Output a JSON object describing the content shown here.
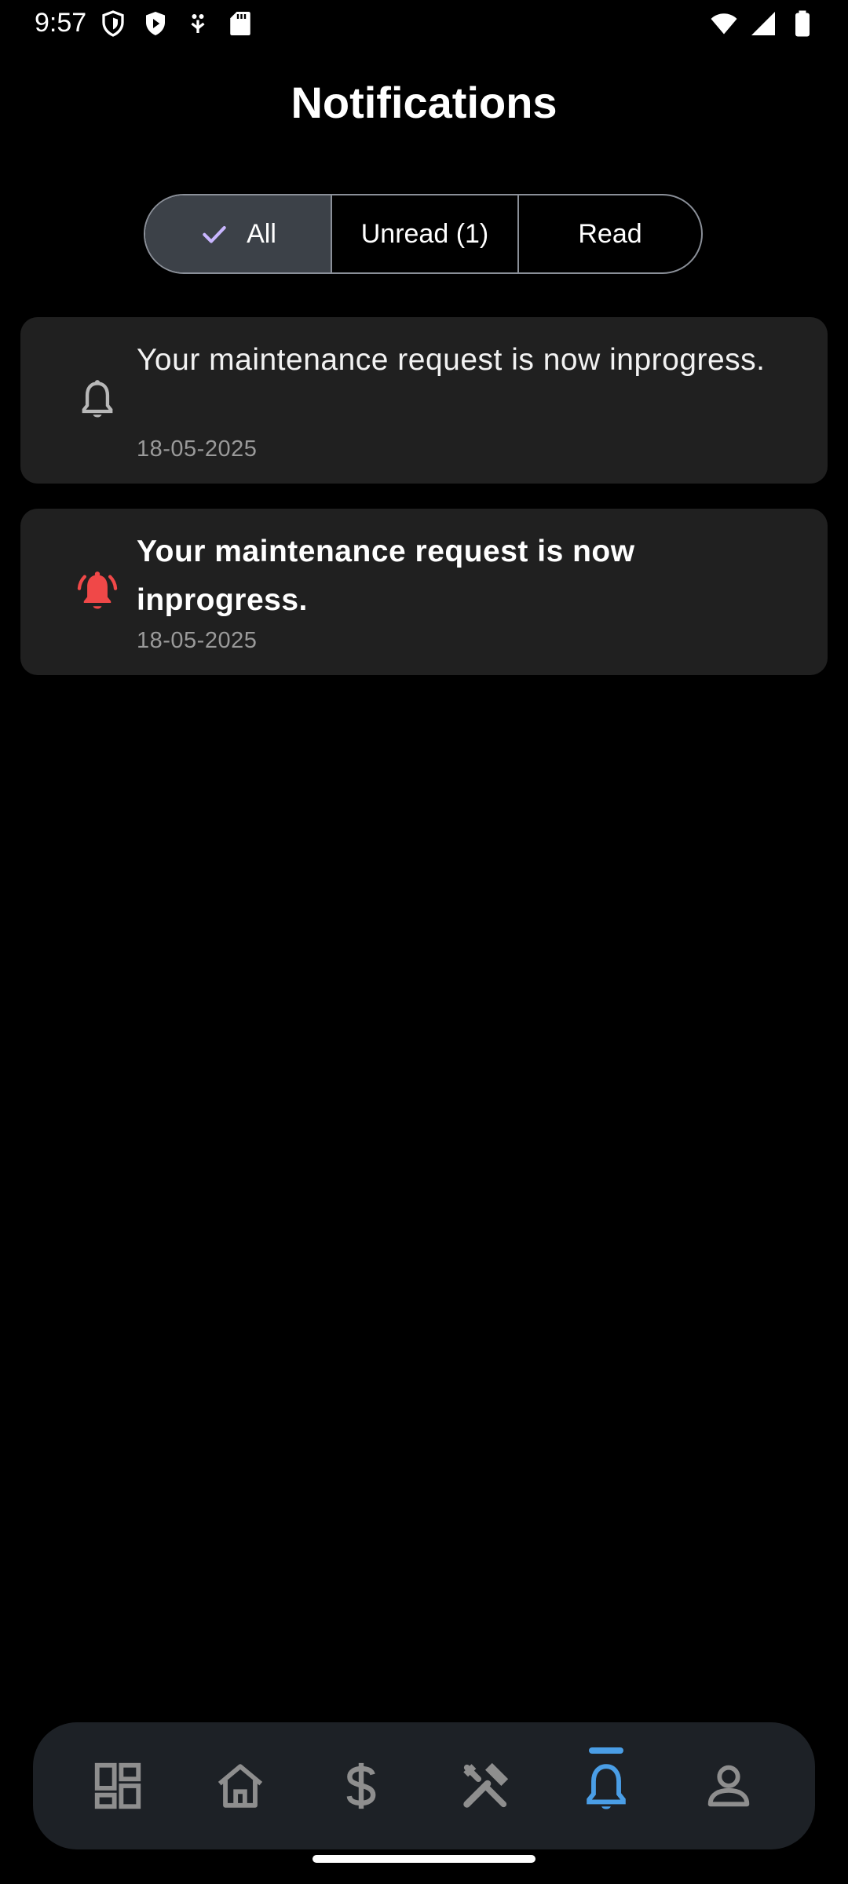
{
  "status_bar": {
    "time": "9:57",
    "left_icons": [
      "shield-icon",
      "play-protect-icon",
      "usb-debug-icon",
      "sd-card-icon"
    ],
    "right_icons": [
      "wifi-icon",
      "signal-icon",
      "battery-icon"
    ]
  },
  "header": {
    "title": "Notifications"
  },
  "filter": {
    "options": [
      {
        "label": "All",
        "selected": true
      },
      {
        "label": "Unread (1)",
        "selected": false
      },
      {
        "label": "Read",
        "selected": false
      }
    ]
  },
  "notifications": [
    {
      "message": "Your maintenance request is now inprogress.",
      "date": "18-05-2025",
      "read": true,
      "icon": "bell-icon"
    },
    {
      "message": "Your maintenance request is now inprogress.",
      "date": "18-05-2025",
      "read": false,
      "icon": "bell-ringing-icon"
    }
  ],
  "bottom_nav": {
    "items": [
      {
        "icon": "dashboard-icon",
        "active": false
      },
      {
        "icon": "home-icon",
        "active": false
      },
      {
        "icon": "dollar-icon",
        "active": false
      },
      {
        "icon": "tools-icon",
        "active": false
      },
      {
        "icon": "bell-icon",
        "active": true
      },
      {
        "icon": "person-icon",
        "active": false
      }
    ]
  },
  "colors": {
    "background": "#000000",
    "card": "#202020",
    "unread_icon": "#f04848",
    "accent": "#4a9ee6",
    "segment_selected": "#3c4148",
    "check": "#c9b6ff"
  }
}
